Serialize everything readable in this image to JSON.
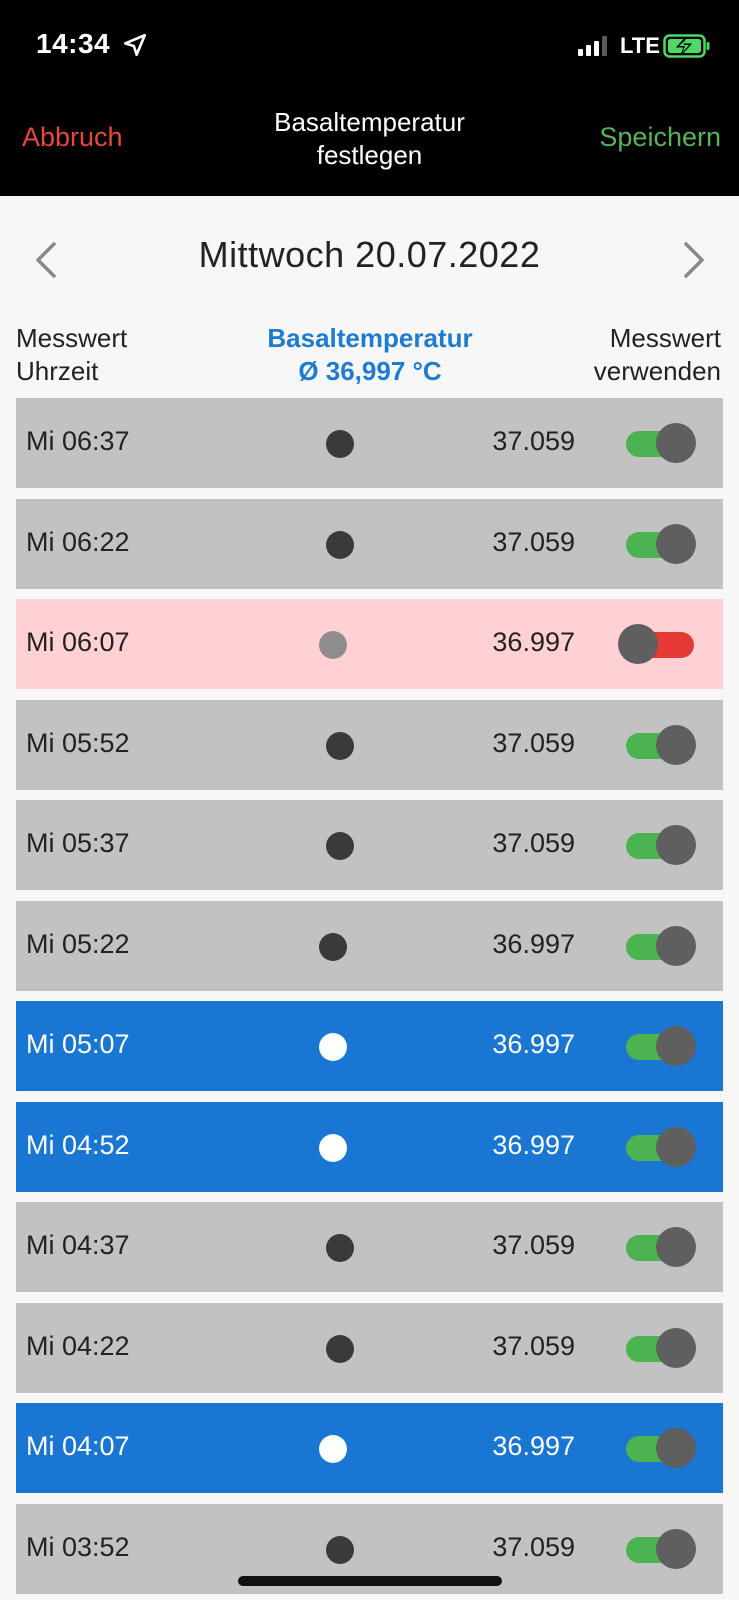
{
  "status_bar": {
    "time": "14:34",
    "network": "LTE"
  },
  "nav": {
    "cancel": "Abbruch",
    "title_line1": "Basaltemperatur",
    "title_line2": "festlegen",
    "save": "Speichern"
  },
  "date": {
    "label": "Mittwoch 20.07.2022"
  },
  "columns": {
    "left_line1": "Messwert",
    "left_line2": "Uhrzeit",
    "mid_line1": "Basaltemperatur",
    "mid_line2": "Ø 36,997 °C",
    "right_line1": "Messwert",
    "right_line2": "verwenden"
  },
  "colors": {
    "accent_blue": "#1976d2",
    "cancel_red": "#e7473c",
    "save_green": "#56b35a",
    "row_grey": "#c2c2c2",
    "row_pink": "#ffd1d4",
    "toggle_on": "#4bb34f",
    "toggle_off": "#e53935"
  },
  "rows": [
    {
      "time": "Mi 06:37",
      "value": "37.059",
      "state": "grey",
      "enabled": true
    },
    {
      "time": "Mi 06:22",
      "value": "37.059",
      "state": "grey",
      "enabled": true
    },
    {
      "time": "Mi 06:07",
      "value": "36.997",
      "state": "pink",
      "enabled": false
    },
    {
      "time": "Mi 05:52",
      "value": "37.059",
      "state": "grey",
      "enabled": true
    },
    {
      "time": "Mi 05:37",
      "value": "37.059",
      "state": "grey",
      "enabled": true
    },
    {
      "time": "Mi 05:22",
      "value": "36.997",
      "state": "grey",
      "enabled": true
    },
    {
      "time": "Mi 05:07",
      "value": "36.997",
      "state": "blue",
      "enabled": true
    },
    {
      "time": "Mi 04:52",
      "value": "36.997",
      "state": "blue",
      "enabled": true
    },
    {
      "time": "Mi 04:37",
      "value": "37.059",
      "state": "grey",
      "enabled": true
    },
    {
      "time": "Mi 04:22",
      "value": "37.059",
      "state": "grey",
      "enabled": true
    },
    {
      "time": "Mi 04:07",
      "value": "36.997",
      "state": "blue",
      "enabled": true
    },
    {
      "time": "Mi 03:52",
      "value": "37.059",
      "state": "grey",
      "enabled": true
    }
  ]
}
